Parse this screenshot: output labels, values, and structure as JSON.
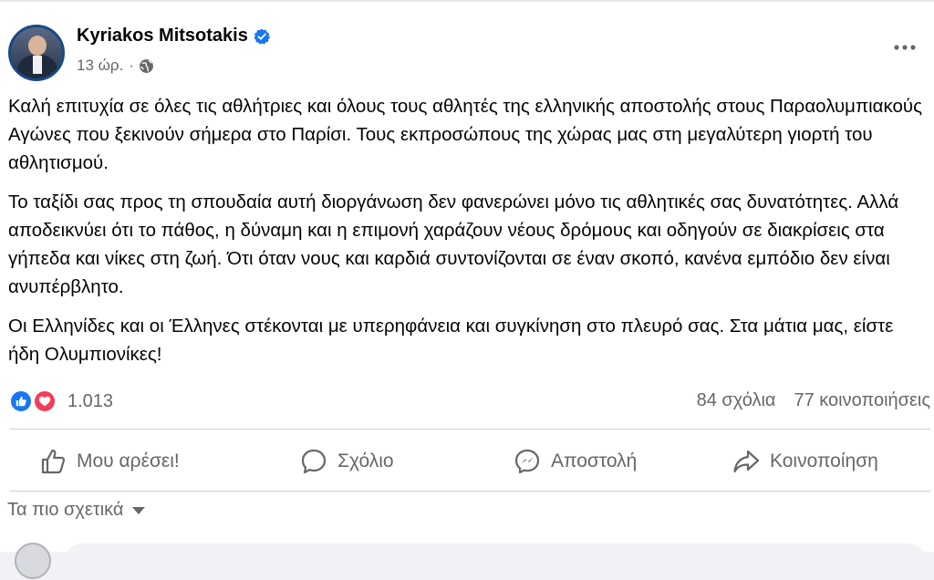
{
  "post": {
    "author": "Kyriakos Mitsotakis",
    "time": "13 ώρ.",
    "paragraphs": [
      "Καλή επιτυχία σε όλες τις αθλήτριες και όλους τους αθλητές της ελληνικής αποστολής στους Παραολυμπιακούς Αγώνες που ξεκινούν σήμερα στο Παρίσι. Τους εκπροσώπους της χώρας μας στη μεγαλύτερη γιορτή του αθλητισμού.",
      "Το ταξίδι σας προς τη σπουδαία αυτή διοργάνωση δεν φανερώνει μόνο τις αθλητικές σας δυνατότητες. Αλλά αποδεικνύει ότι το πάθος, η δύναμη και η επιμονή χαράζουν νέους δρόμους και οδηγούν σε διακρίσεις στα γήπεδα και νίκες στη ζωή. Ότι όταν νους και καρδιά συντονίζονται σε έναν σκοπό, κανένα εμπόδιο δεν είναι ανυπέρβλητο.",
      "Οι Ελληνίδες και οι Έλληνες στέκονται με υπερηφάνεια και συγκίνηση στο πλευρό σας. Στα μάτια μας, είστε ήδη Ολυμπιονίκες!"
    ]
  },
  "stats": {
    "reactions_count": "1.013",
    "comments": "84 σχόλια",
    "shares": "77 κοινοποιήσεις"
  },
  "actions": {
    "like": "Μου αρέσει!",
    "comment": "Σχόλιο",
    "send": "Αποστολή",
    "share": "Κοινοποίηση"
  },
  "comments_filter": {
    "label": "Τα πιο σχετικά"
  },
  "colors": {
    "accent": "#1877f2",
    "love": "#f33e58",
    "secondary_text": "#65676b"
  },
  "icons": [
    "verified-badge-icon",
    "globe-icon",
    "more-options-icon",
    "like-reaction-icon",
    "love-reaction-icon",
    "thumbs-up-icon",
    "comment-bubble-icon",
    "messenger-send-icon",
    "share-arrow-icon",
    "caret-down-icon"
  ]
}
